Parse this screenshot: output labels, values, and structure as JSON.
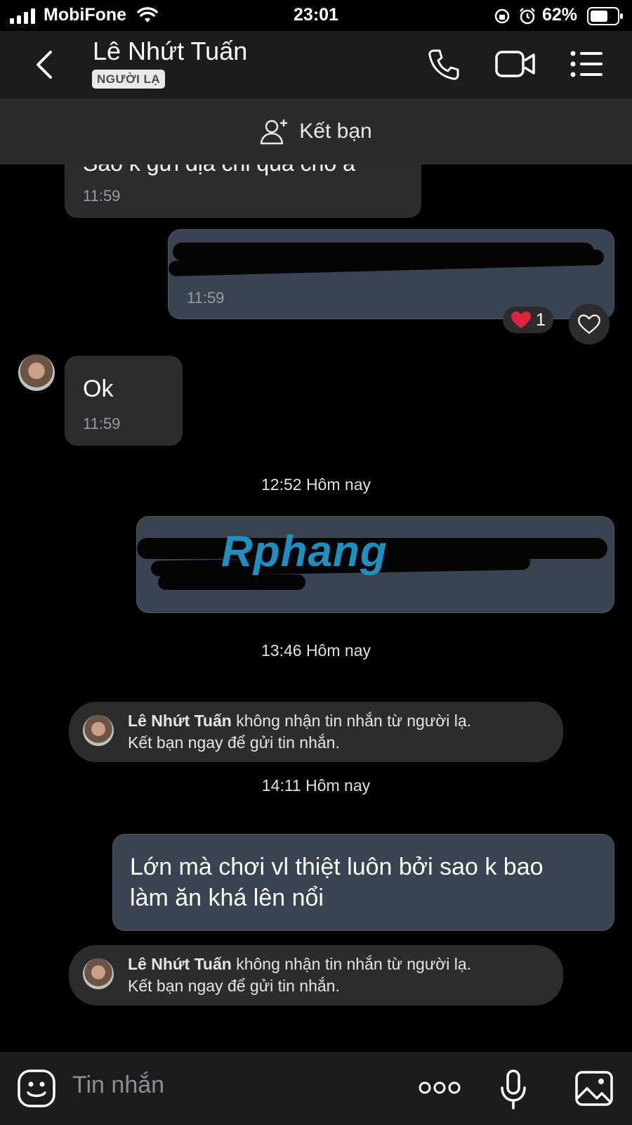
{
  "status_bar": {
    "carrier": "MobiFone",
    "time": "23:01",
    "battery": "62%"
  },
  "header": {
    "contact_name": "Lê Nhứt Tuấn",
    "badge": "NGƯỜI LẠ"
  },
  "add_friend": {
    "label": "Kết bạn"
  },
  "messages": {
    "partial_incoming": {
      "text": "Sao k gửi địa chỉ qua cho a",
      "time": "11:59"
    },
    "outgoing_1": {
      "time": "11:59"
    },
    "reaction": {
      "count": "1"
    },
    "incoming_ok": {
      "text": "Ok",
      "time": "11:59"
    },
    "sep_1": "12:52 Hôm nay",
    "watermark": "Rphang",
    "sep_2": "13:46 Hôm nay",
    "system_1": {
      "name": "Lê Nhứt Tuấn",
      "line1_rest": " không nhận tin nhắn từ người lạ.",
      "line2": "Kết bạn ngay để gửi tin nhắn."
    },
    "sep_3": "14:11 Hôm nay",
    "outgoing_2": {
      "line1": "Lớn mà chơi vl thiệt luôn bởi sao k bao",
      "line2": "làm ăn khá lên nổi"
    },
    "system_2": {
      "name": "Lê Nhứt Tuấn",
      "line1_rest": " không nhận tin nhắn từ người lạ.",
      "line2": "Kết bạn ngay để gửi tin nhắn."
    }
  },
  "input": {
    "placeholder": "Tin nhắn"
  },
  "colors": {
    "background": "#000000",
    "header": "#1c1c1e",
    "incoming_bubble": "#2c2c2e",
    "outgoing_bubble": "#3a4352",
    "heart": "#e0243b"
  }
}
